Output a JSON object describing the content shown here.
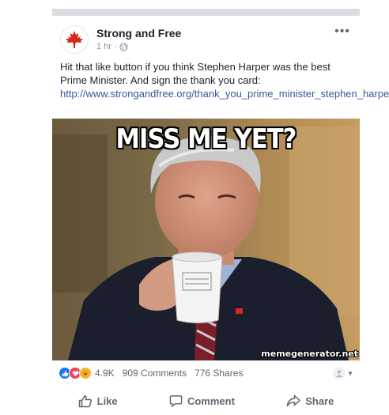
{
  "post": {
    "page_name": "Strong and Free",
    "time": "1 hr",
    "separator": "·",
    "text": "Hit that like button if you think Stephen Harper was the best Prime Minister. And sign the thank you card: ",
    "link": "http://www.strongandfree.org/thank_you_prime_minister_stephen_harper",
    "image": {
      "caption": "MISS ME YET?",
      "watermark": "memegenerator.net"
    }
  },
  "stats": {
    "reaction_count": "4.9K",
    "comments": "909 Comments",
    "shares": "776 Shares",
    "reaction_icons": [
      "like-reaction-icon",
      "love-reaction-icon",
      "haha-reaction-icon"
    ]
  },
  "actions": {
    "like": "Like",
    "comment": "Comment",
    "share": "Share"
  },
  "colors": {
    "link": "#385898",
    "like_blue": "#1877f2",
    "love_red": "#f33e58",
    "haha_yellow": "#f7b125",
    "maple_red": "#d52b1e"
  }
}
